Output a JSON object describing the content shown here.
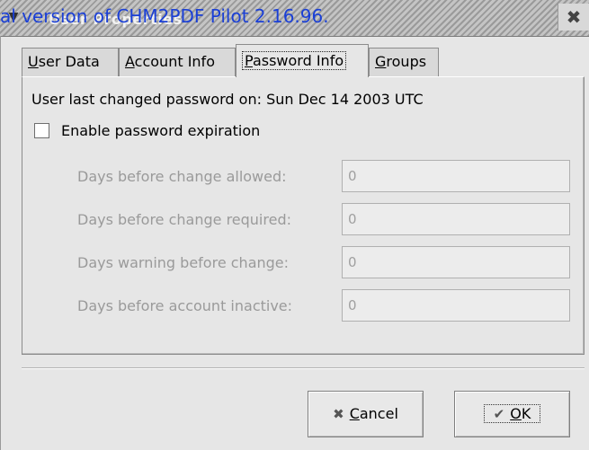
{
  "window": {
    "title": "User Properties",
    "watermark": "al version of CHM2PDF Pilot 2.16.96.",
    "menu_icon": "chevron-down-icon",
    "close_icon": "close-icon"
  },
  "tabs": [
    {
      "label": "User Data",
      "mnemonic": "U",
      "rest": "ser Data",
      "active": false
    },
    {
      "label": "Account Info",
      "mnemonic": "A",
      "rest": "ccount Info",
      "active": false
    },
    {
      "label": "Password Info",
      "mnemonic": "P",
      "rest": "assword Info",
      "active": true
    },
    {
      "label": "Groups",
      "mnemonic": "G",
      "rest": "roups",
      "active": false
    }
  ],
  "password": {
    "last_changed": "User last changed password on: Sun Dec 14 2003 UTC",
    "enable_expiration_label": "Enable password expiration",
    "enable_expiration_checked": false,
    "fields": [
      {
        "label": "Days before change allowed:",
        "value": "0"
      },
      {
        "label": "Days before change required:",
        "value": "0"
      },
      {
        "label": "Days warning before change:",
        "value": "0"
      },
      {
        "label": "Days before account inactive:",
        "value": "0"
      }
    ]
  },
  "buttons": {
    "cancel": {
      "mnemonic": "C",
      "rest": "ancel",
      "icon": "cancel-x-icon"
    },
    "ok": {
      "mnemonic": "O",
      "rest": "K",
      "icon": "checkmark-icon"
    }
  }
}
